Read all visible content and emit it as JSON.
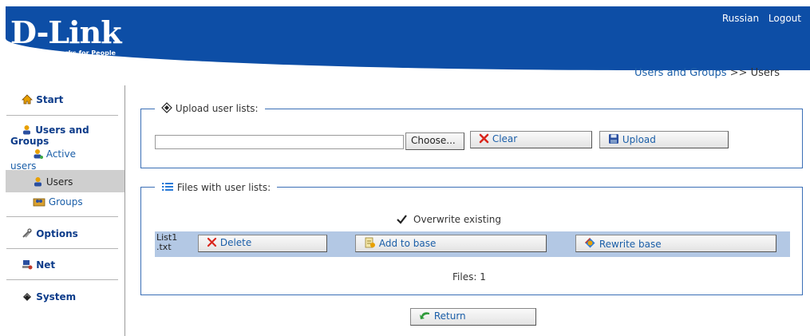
{
  "brand": {
    "name": "D-Link",
    "tagline": "Building Networks for People"
  },
  "top_links": {
    "language": "Russian",
    "logout": "Logout"
  },
  "breadcrumb": {
    "section": "Users and Groups",
    "separator": ">>",
    "current": "Users"
  },
  "sidebar": {
    "start": "Start",
    "users_and_groups_line1": "Users and",
    "users_and_groups_line2": "Groups",
    "active_users_line1": "Active",
    "active_users_line2": "users",
    "users": "Users",
    "groups": "Groups",
    "options": "Options",
    "net": "Net",
    "system": "System"
  },
  "upload": {
    "legend": "Upload user lists:",
    "choose_label": "Choose...",
    "clear_label": "Clear",
    "upload_label": "Upload"
  },
  "files": {
    "legend": "Files with user lists:",
    "overwrite_label": "Overwrite existing",
    "overwrite_checked": true,
    "file_name_line1": "List1",
    "file_name_line2": ".txt",
    "delete_label": "Delete",
    "add_label": "Add to base",
    "rewrite_label": "Rewrite base",
    "count_text": "Files: 1"
  },
  "footer": {
    "return_label": "Return"
  },
  "colors": {
    "header_blue": "#0d4ea6",
    "link_blue": "#1a5ea8",
    "row_blue": "#b3c8e4",
    "selected_gray": "#cfcfcf"
  }
}
